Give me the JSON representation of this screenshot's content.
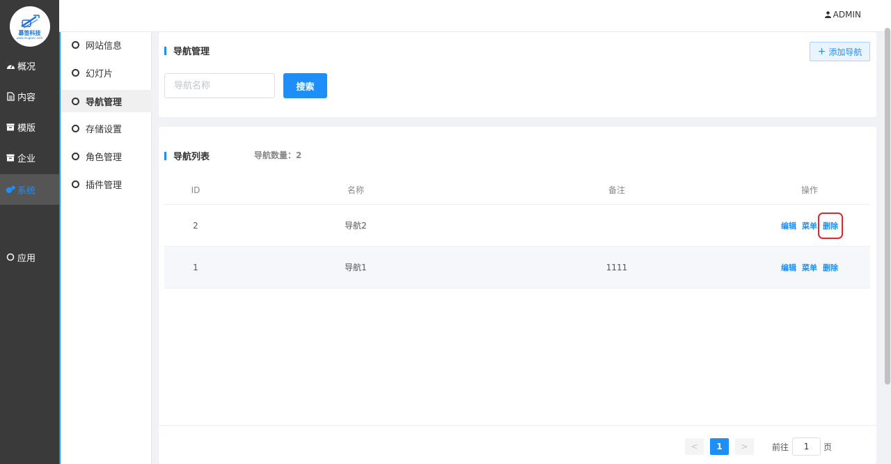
{
  "brand": {
    "name": "慕签科技",
    "sub": "www.muqianc.com"
  },
  "sidebar": {
    "items": [
      {
        "label": "概况",
        "icon": "dashboard-icon"
      },
      {
        "label": "内容",
        "icon": "document-icon"
      },
      {
        "label": "模版",
        "icon": "box-icon"
      },
      {
        "label": "企业",
        "icon": "box-icon"
      },
      {
        "label": "系统",
        "icon": "gears-icon",
        "active": true
      },
      {
        "label": "应用",
        "icon": "circle-icon"
      }
    ]
  },
  "subnav": {
    "items": [
      {
        "label": "网站信息"
      },
      {
        "label": "幻灯片"
      },
      {
        "label": "导航管理",
        "active": true
      },
      {
        "label": "存储设置"
      },
      {
        "label": "角色管理"
      },
      {
        "label": "插件管理"
      }
    ]
  },
  "topbar": {
    "user": "ADMIN"
  },
  "search_card": {
    "title": "导航管理",
    "add_label": "添加导航",
    "input_placeholder": "导航名称",
    "search_label": "搜索"
  },
  "list_card": {
    "title": "导航列表",
    "count_label": "导航数量：2",
    "columns": {
      "id": "ID",
      "name": "名称",
      "note": "备注",
      "ops": "操作"
    },
    "rows": [
      {
        "id": "2",
        "name": "导航2",
        "note": "",
        "ops": [
          "编辑",
          "菜单",
          "删除"
        ]
      },
      {
        "id": "1",
        "name": "导航1",
        "note": "1111",
        "ops": [
          "编辑",
          "菜单",
          "删除"
        ]
      }
    ],
    "pagination": {
      "prev": "<",
      "current": "1",
      "next": ">",
      "goto_label": "前往",
      "goto_value": "1",
      "goto_suffix": "页"
    }
  },
  "colors": {
    "accent": "#1e8ffa",
    "sidebar_bg": "#3a3a3a",
    "highlight_box": "#e8242a"
  }
}
